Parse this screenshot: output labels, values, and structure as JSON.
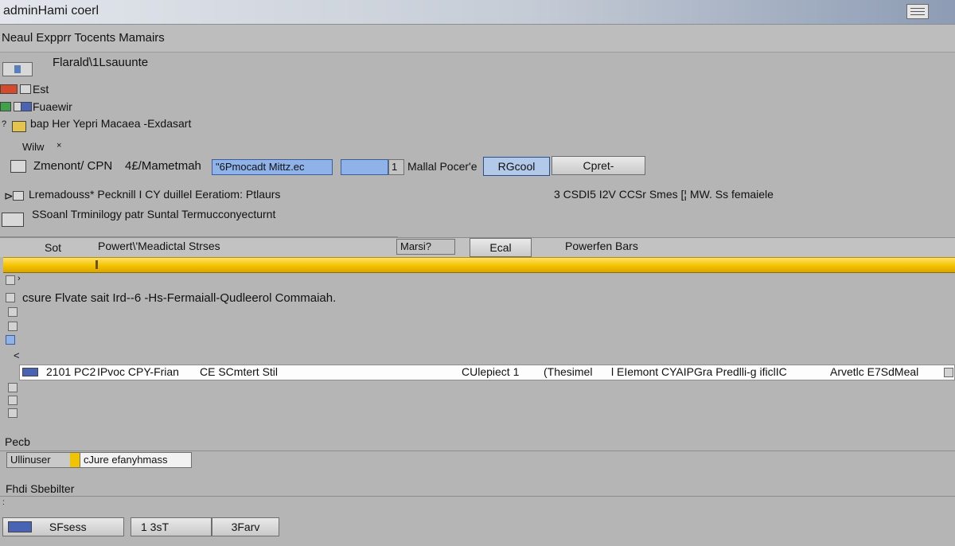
{
  "window": {
    "title": "adminHami coerl"
  },
  "menubar": {
    "text": "Neaul Expprr Tocents Mamairs"
  },
  "options": {
    "heading": "Flarald\\1Lsauunte",
    "items": [
      {
        "label": "Est"
      },
      {
        "label": "Fuaewir"
      },
      {
        "label": "bap Her Yepri Macaea -Exdasart"
      }
    ],
    "sub_label": "Wilw"
  },
  "controls_row": {
    "label": "Zmenont/ CPN",
    "value_label": "4£/Mametmah",
    "field_value": "\"6Pmocadt Mittz.ec",
    "num_value": "1",
    "mode_label": "Mallal Pocer'e",
    "selected_button": "RGcool",
    "cpret_button": "Cpret-"
  },
  "info_row": {
    "left": "Lremadouss* Pecknill I CY duillel Eeratiom: Ptlaurs",
    "right": "3  CSDI5 I2V CCSr Smes [¦ MW. Ss femaiele"
  },
  "terminology": {
    "text": "SSoanl    Trminilogy patr Suntal Termucconyecturnt"
  },
  "filter_row": {
    "sort_label": "Sot",
    "column_header": "Powert\\'Meadictal Strses",
    "mode_field": "Marsi?",
    "end_button": "Ecal",
    "header_right": "Powerfen Bars"
  },
  "list": {
    "description": "csure Flvate sait Ird--6 -Hs-Fermaiall-Qudleerol Commaiah.",
    "row": {
      "id": "2101 PC2",
      "name": "IPvoc CPY-Frian",
      "type": "CE SCmtert Stil",
      "status": "CUlepiect 1",
      "category": "(Thesimel",
      "detail": "l EIemont CYAIPGra Predlli-g ificlIC",
      "amount": "Arvetlc  E7SdMeal"
    }
  },
  "path": {
    "label": "Pecb",
    "tag": "Ullinuser",
    "value": "cJure efanyhmass"
  },
  "stats": {
    "label": "Fhdi Sbebilter"
  },
  "footer": {
    "status_button": "SFsess",
    "page_button": "1  3sT",
    "more_button": "3Farv"
  }
}
